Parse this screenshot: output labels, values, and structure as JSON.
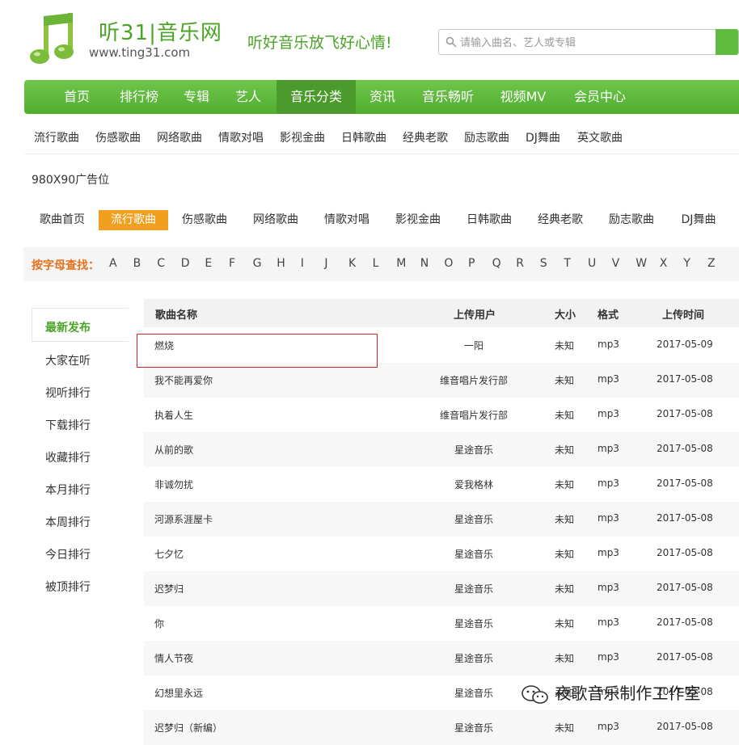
{
  "header": {
    "logo_title": "听31|音乐网",
    "logo_url": "www.ting31.com",
    "slogan": "听好音乐放飞好心情!",
    "search_placeholder": "请输入曲名、艺人或专辑"
  },
  "main_nav": [
    "首页",
    "排行榜",
    "专辑",
    "艺人",
    "音乐分类",
    "资讯",
    "音乐畅听",
    "视频MV",
    "会员中心"
  ],
  "main_nav_active": "音乐分类",
  "sub_nav": [
    "流行歌曲",
    "伤感歌曲",
    "网络歌曲",
    "情歌对唱",
    "影视金曲",
    "日韩歌曲",
    "经典老歌",
    "励志歌曲",
    "DJ舞曲",
    "英文歌曲"
  ],
  "ad_text": "980X90广告位",
  "category_tabs": [
    "歌曲首页",
    "流行歌曲",
    "伤感歌曲",
    "网络歌曲",
    "情歌对唱",
    "影视金曲",
    "日韩歌曲",
    "经典老歌",
    "励志歌曲",
    "DJ舞曲"
  ],
  "category_active": "流行歌曲",
  "alphabet": {
    "label": "按字母查找：",
    "letters": [
      "A",
      "B",
      "C",
      "D",
      "E",
      "F",
      "G",
      "H",
      "I",
      "J",
      "K",
      "L",
      "M",
      "N",
      "O",
      "P",
      "Q",
      "R",
      "S",
      "T",
      "U",
      "V",
      "W",
      "X",
      "Y",
      "Z"
    ]
  },
  "sidebar": [
    "最新发布",
    "大家在听",
    "视听排行",
    "下载排行",
    "收藏排行",
    "本月排行",
    "本周排行",
    "今日排行",
    "被顶排行"
  ],
  "sidebar_active": "最新发布",
  "table": {
    "headers": {
      "name": "歌曲名称",
      "user": "上传用户",
      "size": "大小",
      "format": "格式",
      "time": "上传时间"
    },
    "rows": [
      {
        "name": "燃烧",
        "user": "一阳",
        "size": "未知",
        "format": "mp3",
        "time": "2017-05-09"
      },
      {
        "name": "我不能再爱你",
        "user": "维音唱片发行部",
        "size": "未知",
        "format": "mp3",
        "time": "2017-05-08"
      },
      {
        "name": "执着人生",
        "user": "维音唱片发行部",
        "size": "未知",
        "format": "mp3",
        "time": "2017-05-08"
      },
      {
        "name": "从前的歌",
        "user": "星途音乐",
        "size": "未知",
        "format": "mp3",
        "time": "2017-05-08"
      },
      {
        "name": "非诚勿扰",
        "user": "爱我格林",
        "size": "未知",
        "format": "mp3",
        "time": "2017-05-08"
      },
      {
        "name": "河源系涯屋卡",
        "user": "星途音乐",
        "size": "未知",
        "format": "mp3",
        "time": "2017-05-08"
      },
      {
        "name": "七夕忆",
        "user": "星途音乐",
        "size": "未知",
        "format": "mp3",
        "time": "2017-05-08"
      },
      {
        "name": "迟梦归",
        "user": "星途音乐",
        "size": "未知",
        "format": "mp3",
        "time": "2017-05-08"
      },
      {
        "name": "你",
        "user": "星途音乐",
        "size": "未知",
        "format": "mp3",
        "time": "2017-05-08"
      },
      {
        "name": "情人节夜",
        "user": "星途音乐",
        "size": "未知",
        "format": "mp3",
        "time": "2017-05-08"
      },
      {
        "name": "幻想里永远",
        "user": "星途音乐",
        "size": "未知",
        "format": "mp3",
        "time": "2017-05-08"
      },
      {
        "name": "迟梦归（新编）",
        "user": "星途音乐",
        "size": "未知",
        "format": "mp3",
        "time": "2017-05-08"
      }
    ]
  },
  "watermark": "夜歌音乐制作工作室",
  "colors": {
    "brand_green": "#5fbb3e",
    "active_orange": "#f0a01e",
    "letter_label": "#e8701a",
    "highlight_border": "#d0262a"
  }
}
